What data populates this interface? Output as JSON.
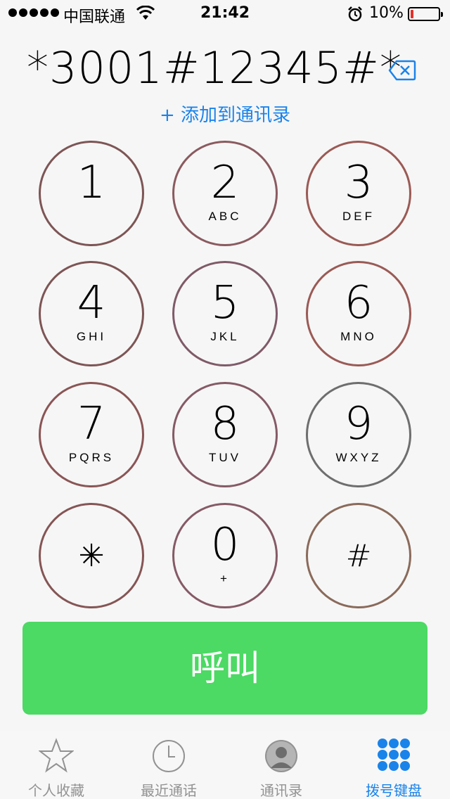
{
  "status": {
    "carrier": "中国联通",
    "time": "21:42",
    "battery": "10%",
    "battery_level": 0.1
  },
  "dialer": {
    "number": "*3001#12345#*",
    "add_contact": "+ 添加到通讯录"
  },
  "keypad": [
    {
      "digit": "1",
      "letters": ""
    },
    {
      "digit": "2",
      "letters": "ABC"
    },
    {
      "digit": "3",
      "letters": "DEF"
    },
    {
      "digit": "4",
      "letters": "GHI"
    },
    {
      "digit": "5",
      "letters": "JKL"
    },
    {
      "digit": "6",
      "letters": "MNO"
    },
    {
      "digit": "7",
      "letters": "PQRS"
    },
    {
      "digit": "8",
      "letters": "TUV"
    },
    {
      "digit": "9",
      "letters": "WXYZ"
    },
    {
      "digit": "✳",
      "letters": ""
    },
    {
      "digit": "0",
      "letters": "+"
    },
    {
      "digit": "#",
      "letters": ""
    }
  ],
  "call_button": "呼叫",
  "tabs": [
    {
      "label": "个人收藏",
      "icon": "star-icon"
    },
    {
      "label": "最近通话",
      "icon": "clock-icon"
    },
    {
      "label": "通讯录",
      "icon": "contacts-icon"
    },
    {
      "label": "拨号键盘",
      "icon": "keypad-icon",
      "active": true
    }
  ],
  "colors": {
    "accent": "#1a83ea",
    "call": "#4cd964",
    "battery_low": "#e3302a"
  }
}
